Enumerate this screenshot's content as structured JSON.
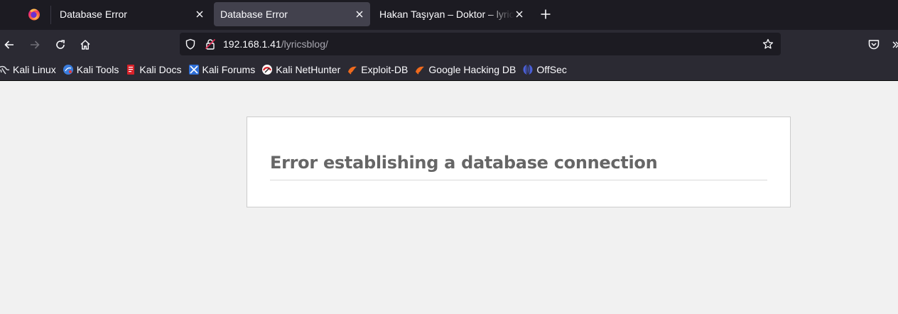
{
  "browser": {
    "tabs": [
      {
        "title": "Database Error",
        "active": false
      },
      {
        "title": "Database Error",
        "active": true
      },
      {
        "title": "Hakan Taşıyan – Doktor – lyricsblog",
        "active": false
      }
    ],
    "new_tab_icon": "plus-icon",
    "close_icon": "close-icon"
  },
  "navbar": {
    "url_host": "192.168.1.41",
    "url_path": "/lyricsblog/",
    "icons": [
      "back-arrow-icon",
      "forward-arrow-icon",
      "reload-icon",
      "home-icon",
      "shield-icon",
      "lock-icon",
      "star-icon",
      "pocket-icon",
      "chevron-right-icon"
    ]
  },
  "bookmarks": [
    {
      "label": "Kali Linux",
      "icon": "kali-dragon-icon"
    },
    {
      "label": "Kali Tools",
      "icon": "kali-tools-icon"
    },
    {
      "label": "Kali Docs",
      "icon": "kali-docs-icon"
    },
    {
      "label": "Kali Forums",
      "icon": "kali-forums-icon"
    },
    {
      "label": "Kali NetHunter",
      "icon": "nethunter-icon"
    },
    {
      "label": "Exploit-DB",
      "icon": "exploit-db-icon"
    },
    {
      "label": "Google Hacking DB",
      "icon": "ghdb-icon"
    },
    {
      "label": "OffSec",
      "icon": "offsec-icon"
    }
  ],
  "page": {
    "error_message": "Error establishing a database connection"
  },
  "colors": {
    "tabstrip_bg": "#1c1b22",
    "toolbar_bg": "#2b2a33",
    "active_tab_bg": "#42414d",
    "page_bg": "#f1f1f1",
    "error_text": "#666666"
  }
}
